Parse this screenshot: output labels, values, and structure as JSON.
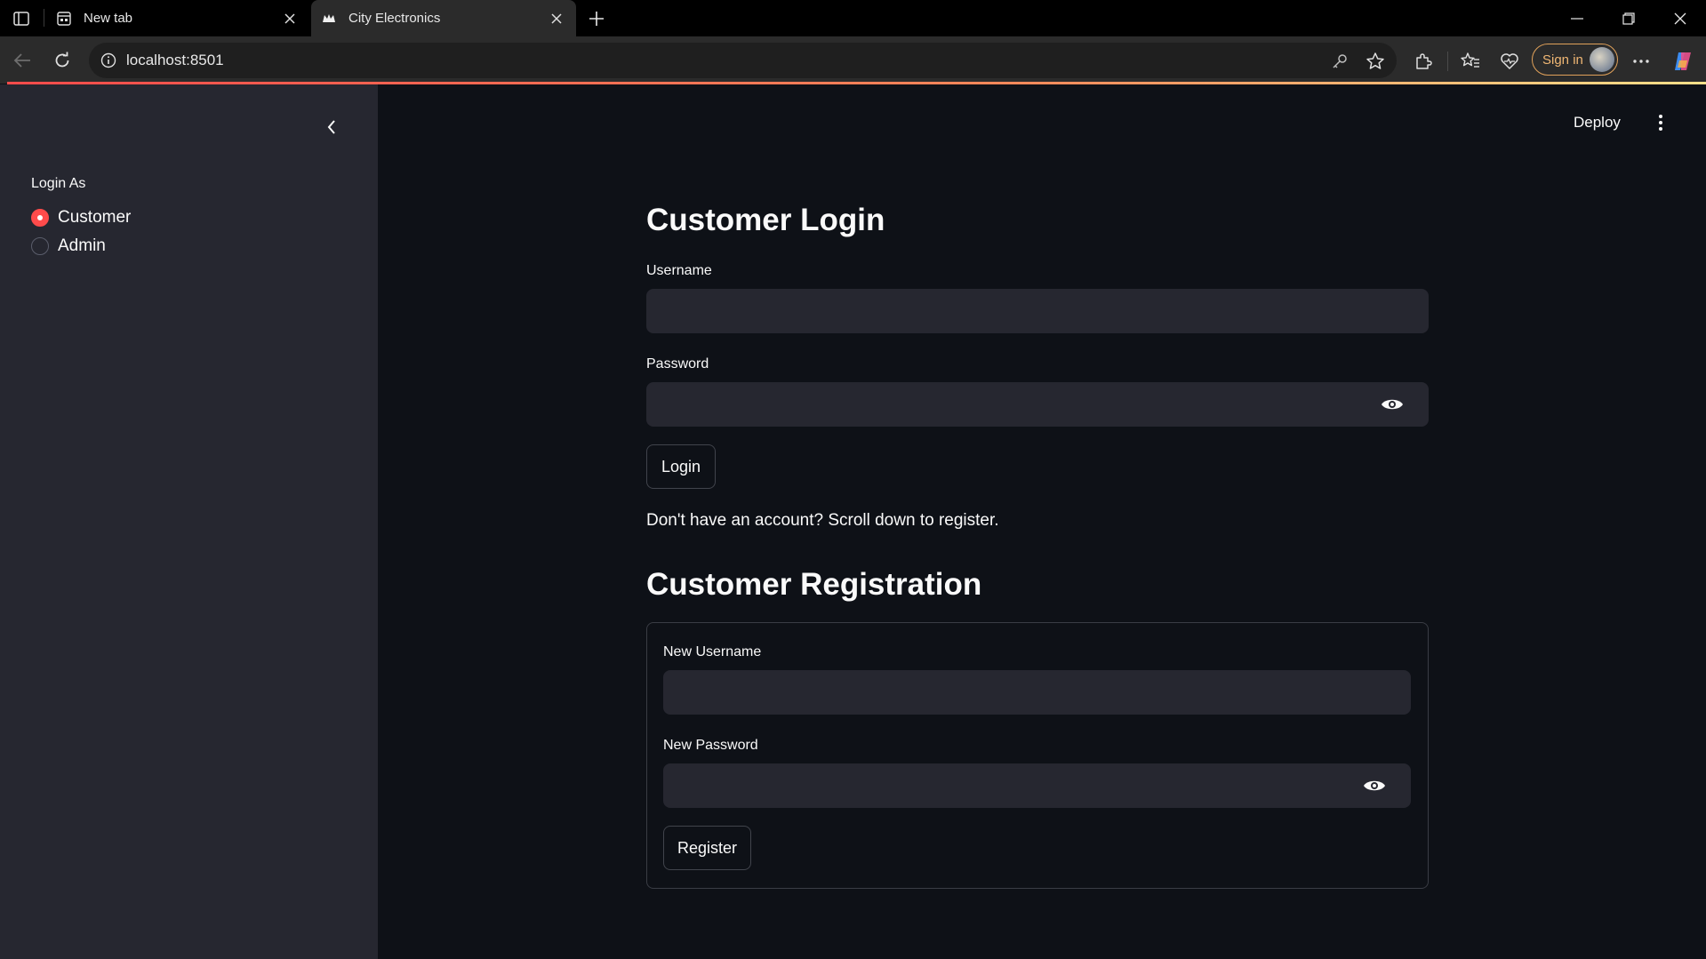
{
  "browser": {
    "tabs": [
      {
        "title": "New tab",
        "icon": "new-tab-page-icon"
      },
      {
        "title": "City Electronics",
        "icon": "streamlit-crown-icon"
      }
    ],
    "url": "localhost:8501",
    "signin_label": "Sign in"
  },
  "sidebar": {
    "radio_label": "Login As",
    "options": [
      {
        "label": "Customer",
        "checked": true
      },
      {
        "label": "Admin",
        "checked": false
      }
    ]
  },
  "header": {
    "deploy_label": "Deploy"
  },
  "login": {
    "title": "Customer Login",
    "username_label": "Username",
    "username_value": "",
    "password_label": "Password",
    "password_value": "",
    "button_label": "Login"
  },
  "register_hint": "Don't have an account? Scroll down to register.",
  "registration": {
    "title": "Customer Registration",
    "username_label": "New Username",
    "username_value": "",
    "password_label": "New Password",
    "password_value": "",
    "button_label": "Register"
  },
  "colors": {
    "accent": "#ff4b4b",
    "background": "#0e1117",
    "sidebar": "#262730",
    "input": "#262730"
  }
}
